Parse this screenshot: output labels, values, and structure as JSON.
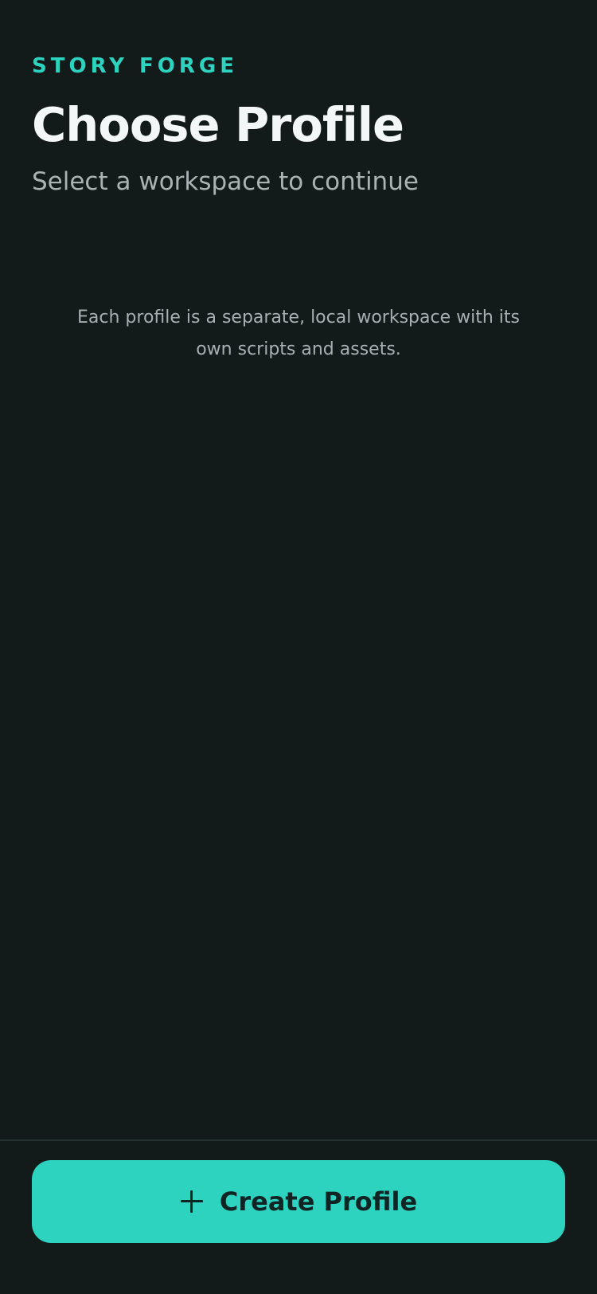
{
  "app": {
    "brand": "STORY FORGE"
  },
  "header": {
    "title": "Choose Profile",
    "subtitle": "Select a workspace to continue"
  },
  "empty_state": {
    "description": "Each profile is a separate, local workspace with its own scripts and assets."
  },
  "actions": {
    "create_profile_label": "Create Profile",
    "create_profile_icon": "plus-icon"
  },
  "colors": {
    "background": "#131a1a",
    "accent": "#2ed3bf",
    "title": "#f4f7f7",
    "muted_text": "#a9b3b2"
  }
}
